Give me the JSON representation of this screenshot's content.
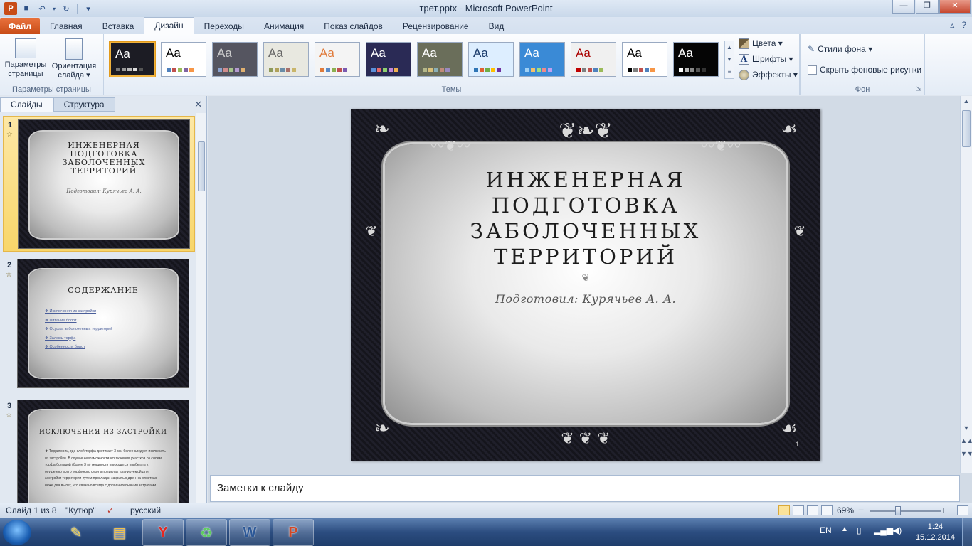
{
  "window": {
    "title": "трет.pptx  -  Microsoft PowerPoint",
    "minimize": "—",
    "maximize": "❐",
    "close": "✕"
  },
  "qat": {
    "save_icon": "💾",
    "undo_icon": "↶",
    "redo_icon": "↻",
    "customize": "▾"
  },
  "tabs": [
    {
      "label": "Файл"
    },
    {
      "label": "Главная"
    },
    {
      "label": "Вставка"
    },
    {
      "label": "Дизайн"
    },
    {
      "label": "Переходы"
    },
    {
      "label": "Анимация"
    },
    {
      "label": "Показ слайдов"
    },
    {
      "label": "Рецензирование"
    },
    {
      "label": "Вид"
    }
  ],
  "ribbon": {
    "page_setup": {
      "btn_params": "Параметры страницы",
      "btn_orientation": "Ориентация слайда ▾",
      "group_label": "Параметры страницы"
    },
    "themes": {
      "group_label": "Темы",
      "aa": "Aa",
      "items": [
        {
          "bg": "#1c1c24",
          "fg": "#ffffff",
          "dots": [
            "#777777",
            "#999999",
            "#bbbbbb",
            "#dddddd",
            "#555555"
          ]
        },
        {
          "bg": "#ffffff",
          "fg": "#000000",
          "dots": [
            "#4f81bd",
            "#c0504d",
            "#9bbb59",
            "#8064a2",
            "#f79646"
          ]
        },
        {
          "bg": "#555560",
          "fg": "#cccccc",
          "dots": [
            "#8ca3d0",
            "#d08c8c",
            "#a7c48a",
            "#b59ad0",
            "#e0b070"
          ]
        },
        {
          "bg": "#e8e8e0",
          "fg": "#666666",
          "dots": [
            "#8e9a5b",
            "#b0a15a",
            "#6a8da8",
            "#a8706a",
            "#c9b56a"
          ]
        },
        {
          "bg": "#f4f4f4",
          "fg": "#e07a3a",
          "dots": [
            "#e07a3a",
            "#5a8ac6",
            "#8cb050",
            "#c05050",
            "#7a5ab0"
          ]
        },
        {
          "bg": "#2a2a55",
          "fg": "#ffffff",
          "dots": [
            "#5b8fd9",
            "#e96b6b",
            "#8dd16e",
            "#c186d9",
            "#f0b050"
          ]
        },
        {
          "bg": "#6a6e5a",
          "fg": "#ffffff",
          "dots": [
            "#b4b88a",
            "#d8c07a",
            "#8ab0b8",
            "#c08a7a",
            "#9a8ac0"
          ]
        },
        {
          "bg": "#ddeeff",
          "fg": "#1a3a6a",
          "dots": [
            "#2e75b6",
            "#e06030",
            "#70ad47",
            "#ffc000",
            "#7030a0"
          ]
        },
        {
          "bg": "#3a8ad6",
          "fg": "#ffffff",
          "dots": [
            "#9fd0f5",
            "#f5c06a",
            "#a0e080",
            "#f08a8a",
            "#c0a0f0"
          ]
        },
        {
          "bg": "#f0f0f0",
          "fg": "#aa0000",
          "dots": [
            "#c00000",
            "#7f7f7f",
            "#c0504d",
            "#4f81bd",
            "#9bbb59"
          ]
        },
        {
          "bg": "#ffffff",
          "fg": "#000000",
          "dots": [
            "#000000",
            "#7f7f7f",
            "#c0504d",
            "#4f81bd",
            "#f79646"
          ]
        },
        {
          "bg": "#050505",
          "fg": "#ffffff",
          "dots": [
            "#ffffff",
            "#bbbbbb",
            "#888888",
            "#555555",
            "#333333"
          ]
        }
      ]
    },
    "theme_options": {
      "colors": "Цвета ▾",
      "fonts": "Шрифты ▾",
      "effects": "Эффекты ▾"
    },
    "background": {
      "styles": "Стили фона ▾",
      "hide": "Скрыть фоновые рисунки",
      "group_label": "Фон"
    }
  },
  "left_panel": {
    "tab_slides": "Слайды",
    "tab_outline": "Структура",
    "close": "✕",
    "slides": [
      {
        "num": "1",
        "title": "ИНЖЕНЕРНАЯ ПОДГОТОВКА ЗАБОЛОЧЕННЫХ ТЕРРИТОРИЙ",
        "sub": "Подготовил: Курячьев А. А."
      },
      {
        "num": "2",
        "title": "СОДЕРЖАНИЕ",
        "bullets": [
          "Исключения из застройки",
          "Питание болот",
          "Осушка заболоченных территорий",
          "Залежь торфа",
          "Особенности болот"
        ]
      },
      {
        "num": "3",
        "title": "ИСКЛЮЧЕНИЯ ИЗ ЗАСТРОЙКИ",
        "body": "Территории, где слой торфа достигает 3 м и более следует исключать из застройки. В случае невозможности исключения участков со слоем торфа большой (более 3 м) мощности приходится прибегать к осушению всего торфяного слоя в пределах планируемой для застройки территории путем прокладки закрытых дрен на отметках ниже два вылет, что связано всегда с дополнительными затратами."
      }
    ]
  },
  "slide": {
    "title": "ИНЖЕНЕРНАЯ ПОДГОТОВКА ЗАБОЛОЧЕННЫХ ТЕРРИТОРИЙ",
    "subtitle": "Подготовил: Курячьев А. А.",
    "number": "1"
  },
  "notes": {
    "placeholder": "Заметки к слайду"
  },
  "status": {
    "slide_info": "Слайд 1 из 8",
    "theme": "\"Кутюр\"",
    "language": "русский",
    "zoom": "69%",
    "zoom_minus": "−",
    "zoom_plus": "+",
    "zoom_fraction": 0.4
  },
  "taskbar": {
    "lang": "EN",
    "time": "1:24",
    "date": "15.12.2014",
    "apps": [
      {
        "name": "drawing-app-icon",
        "glyph": "✎",
        "color": "#f2d24a"
      },
      {
        "name": "explorer-icon",
        "glyph": "▤",
        "color": "#f2c14a"
      },
      {
        "name": "yandex-browser-icon",
        "glyph": "Y",
        "color": "#e52620"
      },
      {
        "name": "image-viewer-icon",
        "glyph": "♻",
        "color": "#5fcf5f"
      },
      {
        "name": "word-icon",
        "glyph": "W",
        "color": "#2b5797"
      },
      {
        "name": "powerpoint-icon",
        "glyph": "P",
        "color": "#d24726"
      }
    ]
  }
}
